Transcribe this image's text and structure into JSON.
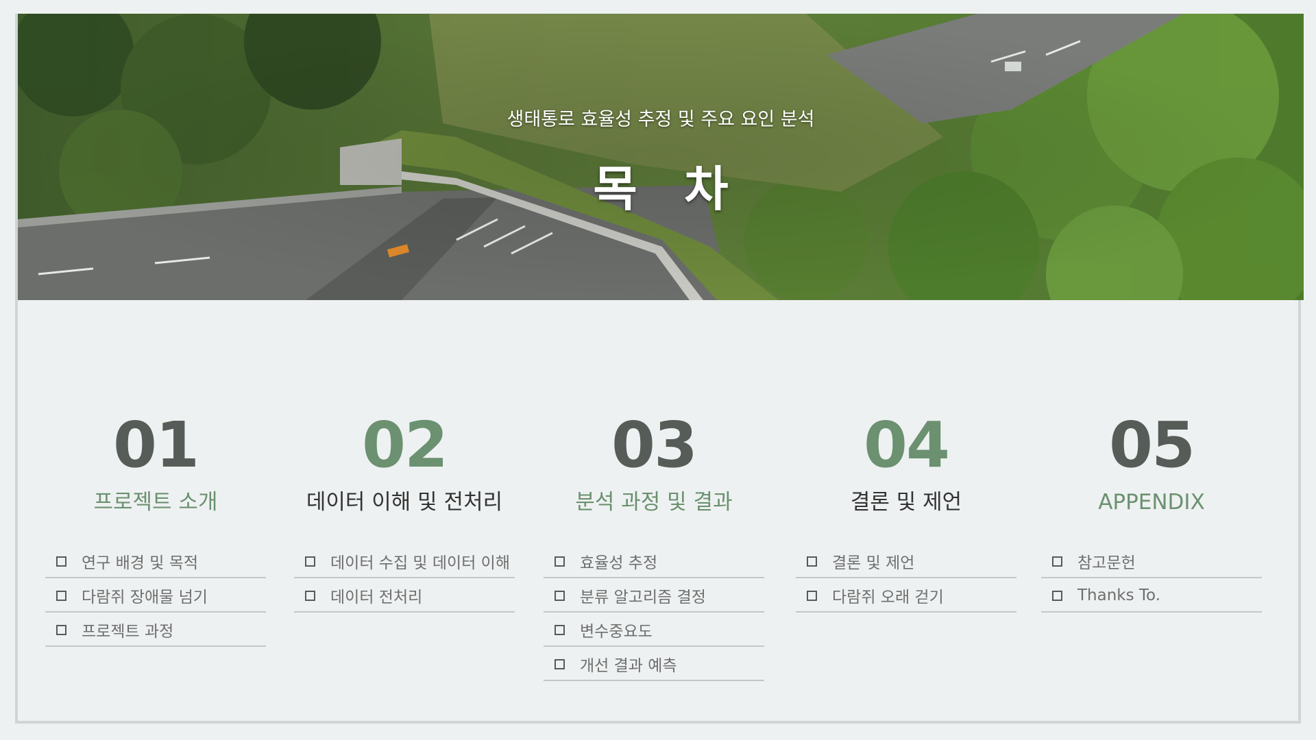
{
  "header": {
    "subtitle": "생태통로 효율성 추정 및 주요 요인 분석",
    "title": "목 차"
  },
  "colors": {
    "accent_green": "#6b9170",
    "dark_gray": "#565c58",
    "background": "#eef1f1"
  },
  "sections": [
    {
      "number": "01",
      "title": "프로젝트 소개",
      "items": [
        "연구 배경 및 목적",
        "다람쥐 장애물 넘기",
        "프로젝트 과정"
      ]
    },
    {
      "number": "02",
      "title": "데이터 이해 및 전처리",
      "items": [
        "데이터 수집 및 데이터 이해",
        "데이터 전처리"
      ]
    },
    {
      "number": "03",
      "title": "분석 과정 및 결과",
      "items": [
        "효율성 추정",
        "분류 알고리즘 결정",
        "변수중요도",
        "개선 결과 예측"
      ]
    },
    {
      "number": "04",
      "title": "결론 및 제언",
      "items": [
        "결론 및 제언",
        "다람쥐 오래 걷기"
      ]
    },
    {
      "number": "05",
      "title": "APPENDIX",
      "items": [
        "참고문헌",
        "Thanks To."
      ]
    }
  ]
}
